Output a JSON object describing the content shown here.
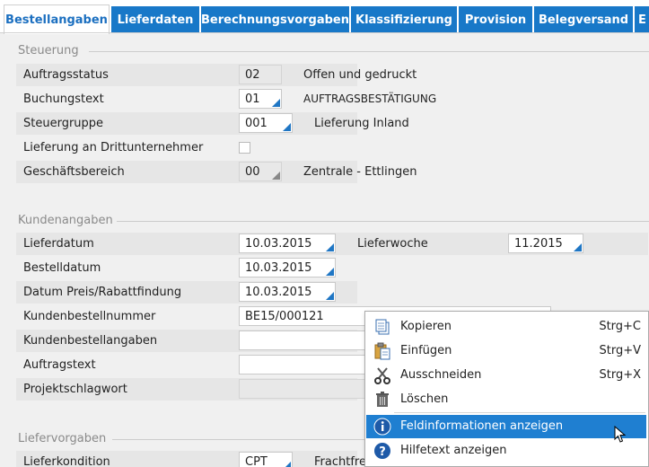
{
  "tabs": [
    {
      "label": "Bestellangaben",
      "active": true
    },
    {
      "label": "Lieferdaten"
    },
    {
      "label": "Berechnungsvorgaben"
    },
    {
      "label": "Klassifizierung"
    },
    {
      "label": "Provision"
    },
    {
      "label": "Belegversand"
    },
    {
      "label": "E"
    }
  ],
  "steuerung": {
    "title": "Steuerung",
    "auftragsstatus": {
      "label": "Auftragsstatus",
      "value": "02",
      "desc": "Offen und gedruckt"
    },
    "buchungstext": {
      "label": "Buchungstext",
      "value": "01",
      "desc": "AUFTRAGSBESTÄTIGUNG"
    },
    "steuergruppe": {
      "label": "Steuergruppe",
      "value": "001",
      "desc": "Lieferung Inland"
    },
    "lieferung_dritt": {
      "label": "Lieferung an Drittunternehmer",
      "checked": false
    },
    "geschaeftsbereich": {
      "label": "Geschäftsbereich",
      "value": "00",
      "desc": "Zentrale - Ettlingen"
    }
  },
  "kundenangaben": {
    "title": "Kundenangaben",
    "lieferdatum": {
      "label": "Lieferdatum",
      "value": "10.03.2015"
    },
    "lieferwoche": {
      "label": "Lieferwoche",
      "value": "11.2015"
    },
    "bestelldatum": {
      "label": "Bestelldatum",
      "value": "10.03.2015"
    },
    "datum_preis": {
      "label": "Datum Preis/Rabattfindung",
      "value": "10.03.2015"
    },
    "kundenbestellnummer": {
      "label": "Kundenbestellnummer",
      "value": "BE15/000121"
    },
    "kundenbestellangaben": {
      "label": "Kundenbestellangaben",
      "value": ""
    },
    "auftragstext": {
      "label": "Auftragstext",
      "value": ""
    },
    "projektschlagwort": {
      "label": "Projektschlagwort",
      "value": ""
    }
  },
  "liefervorgaben": {
    "title": "Liefervorgaben",
    "lieferkondition": {
      "label": "Lieferkondition",
      "value": "CPT"
    },
    "frachtfrei_label": "Frachtfrei"
  },
  "context_menu": {
    "items": [
      {
        "label": "Kopieren",
        "shortcut": "Strg+C",
        "icon": "copy-icon"
      },
      {
        "label": "Einfügen",
        "shortcut": "Strg+V",
        "icon": "paste-icon"
      },
      {
        "label": "Ausschneiden",
        "shortcut": "Strg+X",
        "icon": "scissors-icon"
      },
      {
        "label": "Löschen",
        "shortcut": "",
        "icon": "trash-icon"
      },
      {
        "label": "Feldinformationen anzeigen",
        "shortcut": "",
        "icon": "info-icon",
        "highlighted": true
      },
      {
        "label": "Hilfetext anzeigen",
        "shortcut": "",
        "icon": "help-icon"
      }
    ]
  },
  "colors": {
    "accent": "#1878c8",
    "highlight": "#1f7fd1",
    "band": "#e6e6e6"
  }
}
